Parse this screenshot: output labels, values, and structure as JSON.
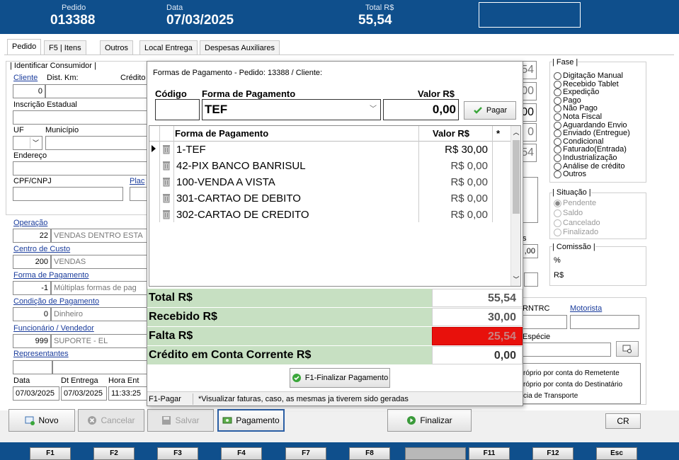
{
  "header": {
    "pedido_label": "Pedido",
    "pedido_value": "013388",
    "data_label": "Data",
    "data_value": "07/03/2025",
    "total_label": "Total R$",
    "total_value": "55,54"
  },
  "tabs": [
    "Pedido",
    "F5 | Itens",
    "Outros",
    "Local Entrega",
    "Despesas Auxiliares"
  ],
  "form": {
    "identificar_label": "| Identificar Consumidor |",
    "cliente_label": "Cliente",
    "dist_label": "Dist. Km:",
    "credito_label": "Crédito",
    "cliente_value": "0",
    "ie_label": "Inscrição Estadual",
    "uf_label": "UF",
    "municipio_label": "Município",
    "endereco_label": "Endereço",
    "cpf_label": "CPF/CNPJ",
    "placa_label": "Plac",
    "operacao_label": "Operação",
    "operacao_code": "22",
    "operacao_desc": "VENDAS DENTRO ESTA",
    "centro_label": "Centro de Custo",
    "centro_code": "200",
    "centro_desc": "VENDAS",
    "forma_label": "Forma de Pagamento",
    "forma_code": "-1",
    "forma_desc": "Múltiplas formas de pag",
    "condicao_label": "Condição de Pagamento",
    "condicao_code": "0",
    "condicao_desc": "Dinheiro",
    "func_label": "Funcionário / Vendedor",
    "func_code": "999",
    "func_desc": "SUPORTE - EL",
    "rep_label": "Representantes",
    "data_label": "Data",
    "dt_entrega_label": "Dt Entrega",
    "hora_label": "Hora Ent",
    "data_value": "07/03/2025",
    "dt_entrega_value": "07/03/2025",
    "hora_value": "11:33:25"
  },
  "right_inputs": [
    "54",
    "00",
    "00",
    "0",
    "54"
  ],
  "fase": {
    "title": "| Fase |",
    "options": [
      "Digitação Manual",
      "Recebido Tablet",
      "Expedição",
      "Pago",
      "Não Pago",
      "Nota Fiscal",
      "Aguardando Envio",
      "Enviado (Entregue)",
      "Condicional",
      "Faturado(Entrada)",
      "Industrialização",
      "Análise de crédito",
      "Outros"
    ]
  },
  "situacao": {
    "title": "| Situação |",
    "options": [
      "Pendente",
      "Saldo",
      "Cancelado",
      "Finalizado"
    ]
  },
  "comissao": {
    "title": "| Comissão |",
    "pct": "%",
    "rs": "R$",
    "partial_s": "s",
    "partial_val": ",00"
  },
  "transport": {
    "rntrc": "RNTRC",
    "motorista": "Motorista",
    "especie": "Espécie",
    "opt1": "róprio por conta do Remetente",
    "opt2": "róprio por conta do Destinatário",
    "opt3": "cia de Transporte"
  },
  "modal": {
    "title": "Formas de Pagamento - Pedido: 13388 / Cliente:",
    "codigo_label": "Código",
    "forma_label": "Forma de Pagamento",
    "valor_label": "Valor R$",
    "forma_value": "TEF",
    "valor_value": "0,00",
    "pagar_label": "Pagar",
    "grid_headers": [
      "Forma de Pagamento",
      "Valor R$",
      "*"
    ],
    "rows": [
      {
        "forma": "1-TEF",
        "valor": "R$ 30,00"
      },
      {
        "forma": "42-PIX BANCO BANRISUL",
        "valor": "R$ 0,00"
      },
      {
        "forma": "100-VENDA A VISTA",
        "valor": "R$ 0,00"
      },
      {
        "forma": "301-CARTAO DE DEBITO",
        "valor": "R$ 0,00"
      },
      {
        "forma": "302-CARTAO DE CREDITO",
        "valor": "R$ 0,00"
      }
    ],
    "total_label": "Total R$",
    "total_value": "55,54",
    "recebido_label": "Recebido R$",
    "recebido_value": "30,00",
    "falta_label": "Falta R$",
    "falta_value": "25,54",
    "credito_label": "Crédito em Conta Corrente R$",
    "credito_value": "0,00",
    "finalizar_label": "F1-Finalizar Pagamento",
    "status_left": "F1-Pagar",
    "status_right": "*Visualizar faturas, caso, as mesmas ja tiverem sido geradas",
    "falta_color": "#e8110c"
  },
  "buttons": {
    "novo": "Novo",
    "cancelar": "Cancelar",
    "salvar": "Salvar",
    "pagamento": "Pagamento",
    "finalizar": "Finalizar",
    "cr": "CR"
  },
  "fkeys": [
    "F1",
    "F2",
    "F3",
    "F4",
    "F7",
    "F8",
    "",
    "F11",
    "F12",
    "Esc"
  ]
}
